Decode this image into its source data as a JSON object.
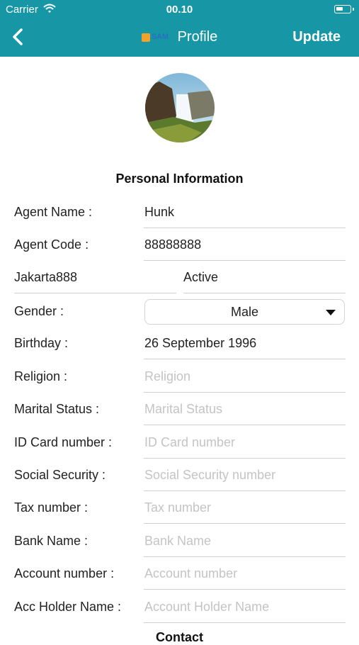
{
  "status_bar": {
    "carrier": "Carrier",
    "time": "00.10"
  },
  "nav": {
    "logo_text": "SAM",
    "title": "Profile",
    "update_label": "Update"
  },
  "section_title": "Personal Information",
  "agent_name": {
    "label": "Agent Name :",
    "value": "Hunk"
  },
  "agent_code": {
    "label": "Agent Code :",
    "value": "88888888"
  },
  "branch": {
    "value": "Jakarta888"
  },
  "status": {
    "value": "Active"
  },
  "gender": {
    "label": "Gender :",
    "value": "Male"
  },
  "birthday": {
    "label": "Birthday :",
    "value": "26 September 1996"
  },
  "religion": {
    "label": "Religion :",
    "placeholder": "Religion"
  },
  "marital": {
    "label": "Marital Status :",
    "placeholder": "Marital Status"
  },
  "id_card": {
    "label": "ID Card number :",
    "placeholder": "ID Card number"
  },
  "social": {
    "label": "Social Security  :",
    "placeholder": "Social Security number"
  },
  "tax": {
    "label": "Tax number :",
    "placeholder": "Tax number"
  },
  "bank": {
    "label": "Bank Name :",
    "placeholder": "Bank Name"
  },
  "account": {
    "label": "Account number :",
    "placeholder": "Account number"
  },
  "holder": {
    "label": "Acc Holder Name :",
    "placeholder": "Account Holder Name"
  },
  "contact_title": "Contact",
  "colors": {
    "accent": "#1797a6",
    "placeholder": "#c4c4c4",
    "divider": "#cfcfcf"
  }
}
